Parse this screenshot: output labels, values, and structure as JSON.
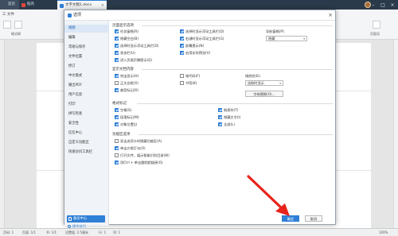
{
  "top_tabs": {
    "home": "首页",
    "template": "稻壳",
    "document": "文字文稿1.docx"
  },
  "ribbon": {
    "menu_label": "三 文件",
    "format_painter": "格式刷",
    "page_label": "页面设"
  },
  "dialog": {
    "title": "选项",
    "close_glyph": "×",
    "sidebar": {
      "items": [
        {
          "label": "视图",
          "active": true
        },
        {
          "label": "编辑",
          "active": false
        },
        {
          "label": "常规与保存",
          "active": false
        },
        {
          "label": "文件位置",
          "active": false
        },
        {
          "label": "修订",
          "active": false
        },
        {
          "label": "中文版式",
          "active": false
        },
        {
          "label": "输出PDF",
          "active": false
        },
        {
          "label": "用户信息",
          "active": false
        },
        {
          "label": "打印",
          "active": false
        },
        {
          "label": "拼写检查",
          "active": false
        },
        {
          "label": "安全性",
          "active": false
        },
        {
          "label": "信任中心",
          "active": false
        },
        {
          "label": "自定义功能区",
          "active": false
        },
        {
          "label": "快速访问工具栏",
          "active": false
        }
      ],
      "backup_center": "备份中心",
      "tips_link": "操作技巧"
    },
    "page_display": {
      "heading": "页面显示选项",
      "col1": [
        {
          "label": "任务窗格(R)",
          "checked": true
        },
        {
          "label": "隐藏空白(B)",
          "checked": true
        },
        {
          "label": "选择时显示浮动工具栏(D)",
          "checked": true
        },
        {
          "label": "状态栏(U)",
          "checked": true
        },
        {
          "label": "进入页眉页脚提示(Q)",
          "checked": true
        }
      ],
      "col2": [
        {
          "label": "选择时显示浮动工具栏(D)",
          "checked": true
        },
        {
          "label": "右键时显示浮动工具栏(G)",
          "checked": true
        },
        {
          "label": "屏幕提示(N)",
          "checked": true
        },
        {
          "label": "启用实时预览(V)",
          "checked": true
        }
      ],
      "nav_label": "导航窗格(P):",
      "nav_value": "隐藏",
      "nav_arrow": "▾"
    },
    "formatting": {
      "heading": "显示文档内容",
      "col1": [
        {
          "label": "突出显示(H)",
          "checked": true
        },
        {
          "label": "正文边框(X)",
          "checked": false
        },
        {
          "label": "裁剪标记(R)",
          "checked": true
        }
      ],
      "col2": [
        {
          "label": "域代码(F)",
          "checked": false
        },
        {
          "label": "书签(K)",
          "checked": false
        }
      ],
      "field_shading_label": "域底纹(E):",
      "field_shading_value": "选取时显示",
      "field_shading_arrow": "▾",
      "font_substitution": "字体替换(O)..."
    },
    "format_marks": {
      "heading": "格式标记",
      "col1": [
        {
          "label": "空格(S)",
          "checked": true
        },
        {
          "label": "段落标记(M)",
          "checked": true
        },
        {
          "label": "对象位置(J)",
          "checked": true
        }
      ],
      "col2": [
        {
          "label": "制表符(T)",
          "checked": true
        },
        {
          "label": "隐藏文字(I)",
          "checked": true
        },
        {
          "label": "全部(L)",
          "checked": true
        }
      ]
    },
    "features": {
      "heading": "功能区选项",
      "items": [
        {
          "label": "双击选项卡时隐藏功能区(A)",
          "checked": false
        },
        {
          "label": "单击方框打勾(O)",
          "checked": true
        },
        {
          "label": "打开文件，展示智能识别目录(W)",
          "checked": false
        },
        {
          "label": "用Ctrl + 单击跟踪超链接(O)",
          "checked": true
        }
      ]
    },
    "ok_label": "确定",
    "cancel_label": "取消"
  },
  "statusbar": {
    "page": "页码: 1",
    "pages": "页面: 1/1",
    "section": "节: 1/1",
    "settings": "设置值: 2.5厘米",
    "row": "行: 1",
    "col": "列: 1",
    "zoom": "100%"
  },
  "colors": {
    "accent": "#2f7fd6",
    "tabbar": "#2b3a4a",
    "arrow": "#e8231b"
  }
}
